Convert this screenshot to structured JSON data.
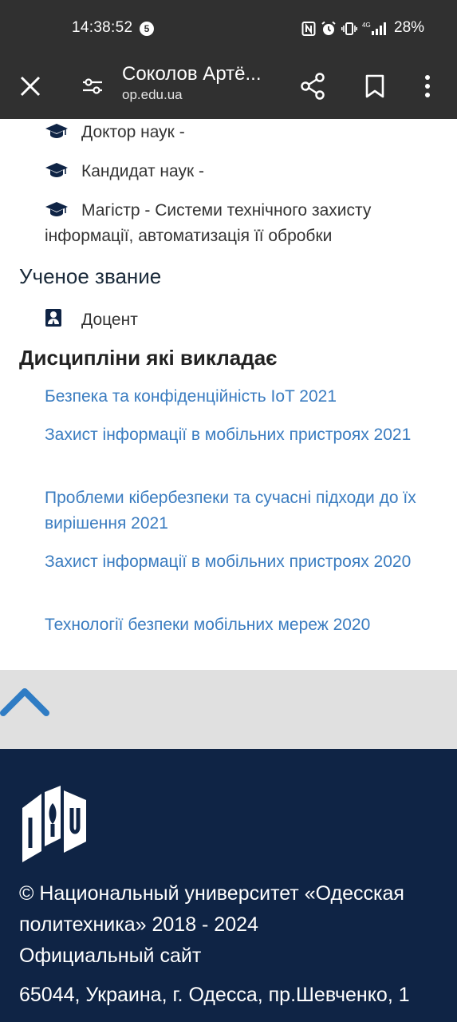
{
  "status_bar": {
    "time": "14:38:52",
    "notification_count": "5",
    "battery": "28%",
    "network": "4G"
  },
  "app_bar": {
    "title": "Соколов Артё...",
    "url": "op.edu.ua"
  },
  "degrees": [
    {
      "text": "Доктор наук -"
    },
    {
      "text": "Кандидат наук -"
    },
    {
      "text": "Магістр - Системи технічного захисту інформації, автоматизація її обробки"
    }
  ],
  "rank_section": {
    "heading": "Ученое звание",
    "value": "Доцент"
  },
  "disciplines_section": {
    "heading": "Дисципліни які викладає",
    "items": [
      "Безпека та конфіденційність IoT 2021",
      "Захист інформації в мобільних пристроях 2021",
      "Проблеми кібербезпеки та сучасні підходи до їх вирішення 2021",
      "Захист інформації в мобільних пристроях 2020",
      "Технології безпеки мобільних мереж 2020"
    ]
  },
  "footer": {
    "copyright_line1": "© Национальный университет «Одесская",
    "copyright_line2": "политехника» 2018 - 2024",
    "copyright_line3": "Официальный сайт",
    "address": "65044, Украина, г. Одесса, пр.Шевченко, 1"
  },
  "colors": {
    "chrome": "#303030",
    "link": "#3a7cc0",
    "footer": "#0f2445",
    "accent_arrow": "#2f7cc4",
    "icon": "#0f2445"
  },
  "icons": {
    "close": "close-icon",
    "tune": "tune-icon",
    "share": "share-icon",
    "bookmark": "bookmark-icon",
    "menu": "more-vert-icon",
    "degree": "graduation-cap-icon",
    "rank": "teacher-icon",
    "scroll_top": "chevron-up-icon",
    "logo": "university-logo"
  }
}
